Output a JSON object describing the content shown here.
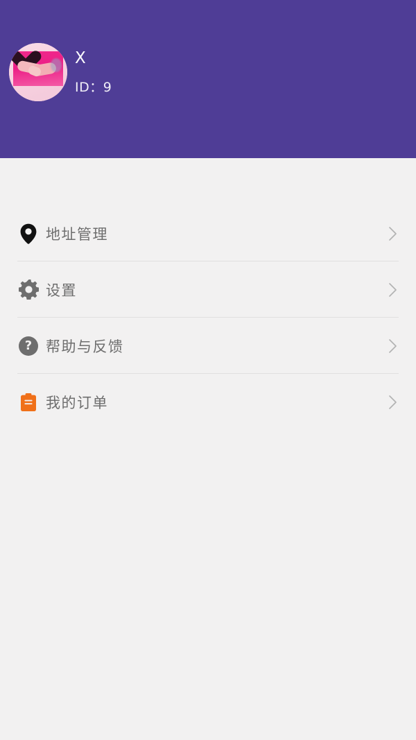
{
  "header": {
    "background_color": "#4f3d96",
    "avatar": {
      "icon": "user-avatar-photo",
      "description": "pink photo of two hands and a dark heart"
    },
    "user_name": "X",
    "user_id_label": "ID：9"
  },
  "page": {
    "background_color": "#f2f1f1"
  },
  "menu": {
    "items": [
      {
        "label": "地址管理",
        "icon": "location-pin-icon",
        "icon_color": "#111111",
        "chevron": "chevron-right-icon"
      },
      {
        "label": "设置",
        "icon": "gear-icon",
        "icon_color": "#6e6e6e",
        "chevron": "chevron-right-icon"
      },
      {
        "label": "帮助与反馈",
        "icon": "question-circle-icon",
        "icon_color": "#6e6e6e",
        "chevron": "chevron-right-icon",
        "glyph": "?"
      },
      {
        "label": "我的订单",
        "icon": "clipboard-order-icon",
        "icon_color": "#f07019",
        "chevron": "chevron-right-icon"
      }
    ]
  }
}
